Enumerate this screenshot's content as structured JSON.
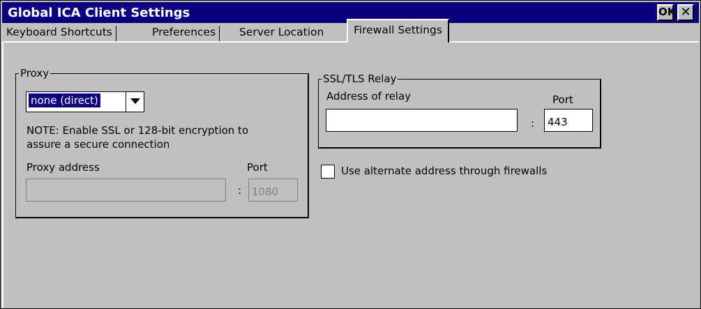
{
  "window": {
    "title": "Global ICA Client Settings",
    "ok_label": "OK",
    "close_label": "✕"
  },
  "tabs": [
    {
      "label": "Keyboard Shortcuts",
      "active": false
    },
    {
      "label": "Preferences",
      "active": false
    },
    {
      "label": "Server Location",
      "active": false
    },
    {
      "label": "Firewall Settings",
      "active": true
    }
  ],
  "proxy": {
    "group_label": "Proxy",
    "type_selected": "none (direct)",
    "note": "NOTE: Enable SSL or 128-bit encryption to assure a secure connection",
    "address_label": "Proxy address",
    "address_value": "",
    "port_label": "Port",
    "port_value": "1080",
    "colon": ":"
  },
  "ssl_relay": {
    "group_label": "SSL/TLS Relay",
    "address_label": "Address of relay",
    "address_value": "",
    "port_label": "Port",
    "port_value": "443",
    "colon": ":"
  },
  "alternate_address": {
    "label": "Use alternate address through firewalls",
    "checked": false
  }
}
